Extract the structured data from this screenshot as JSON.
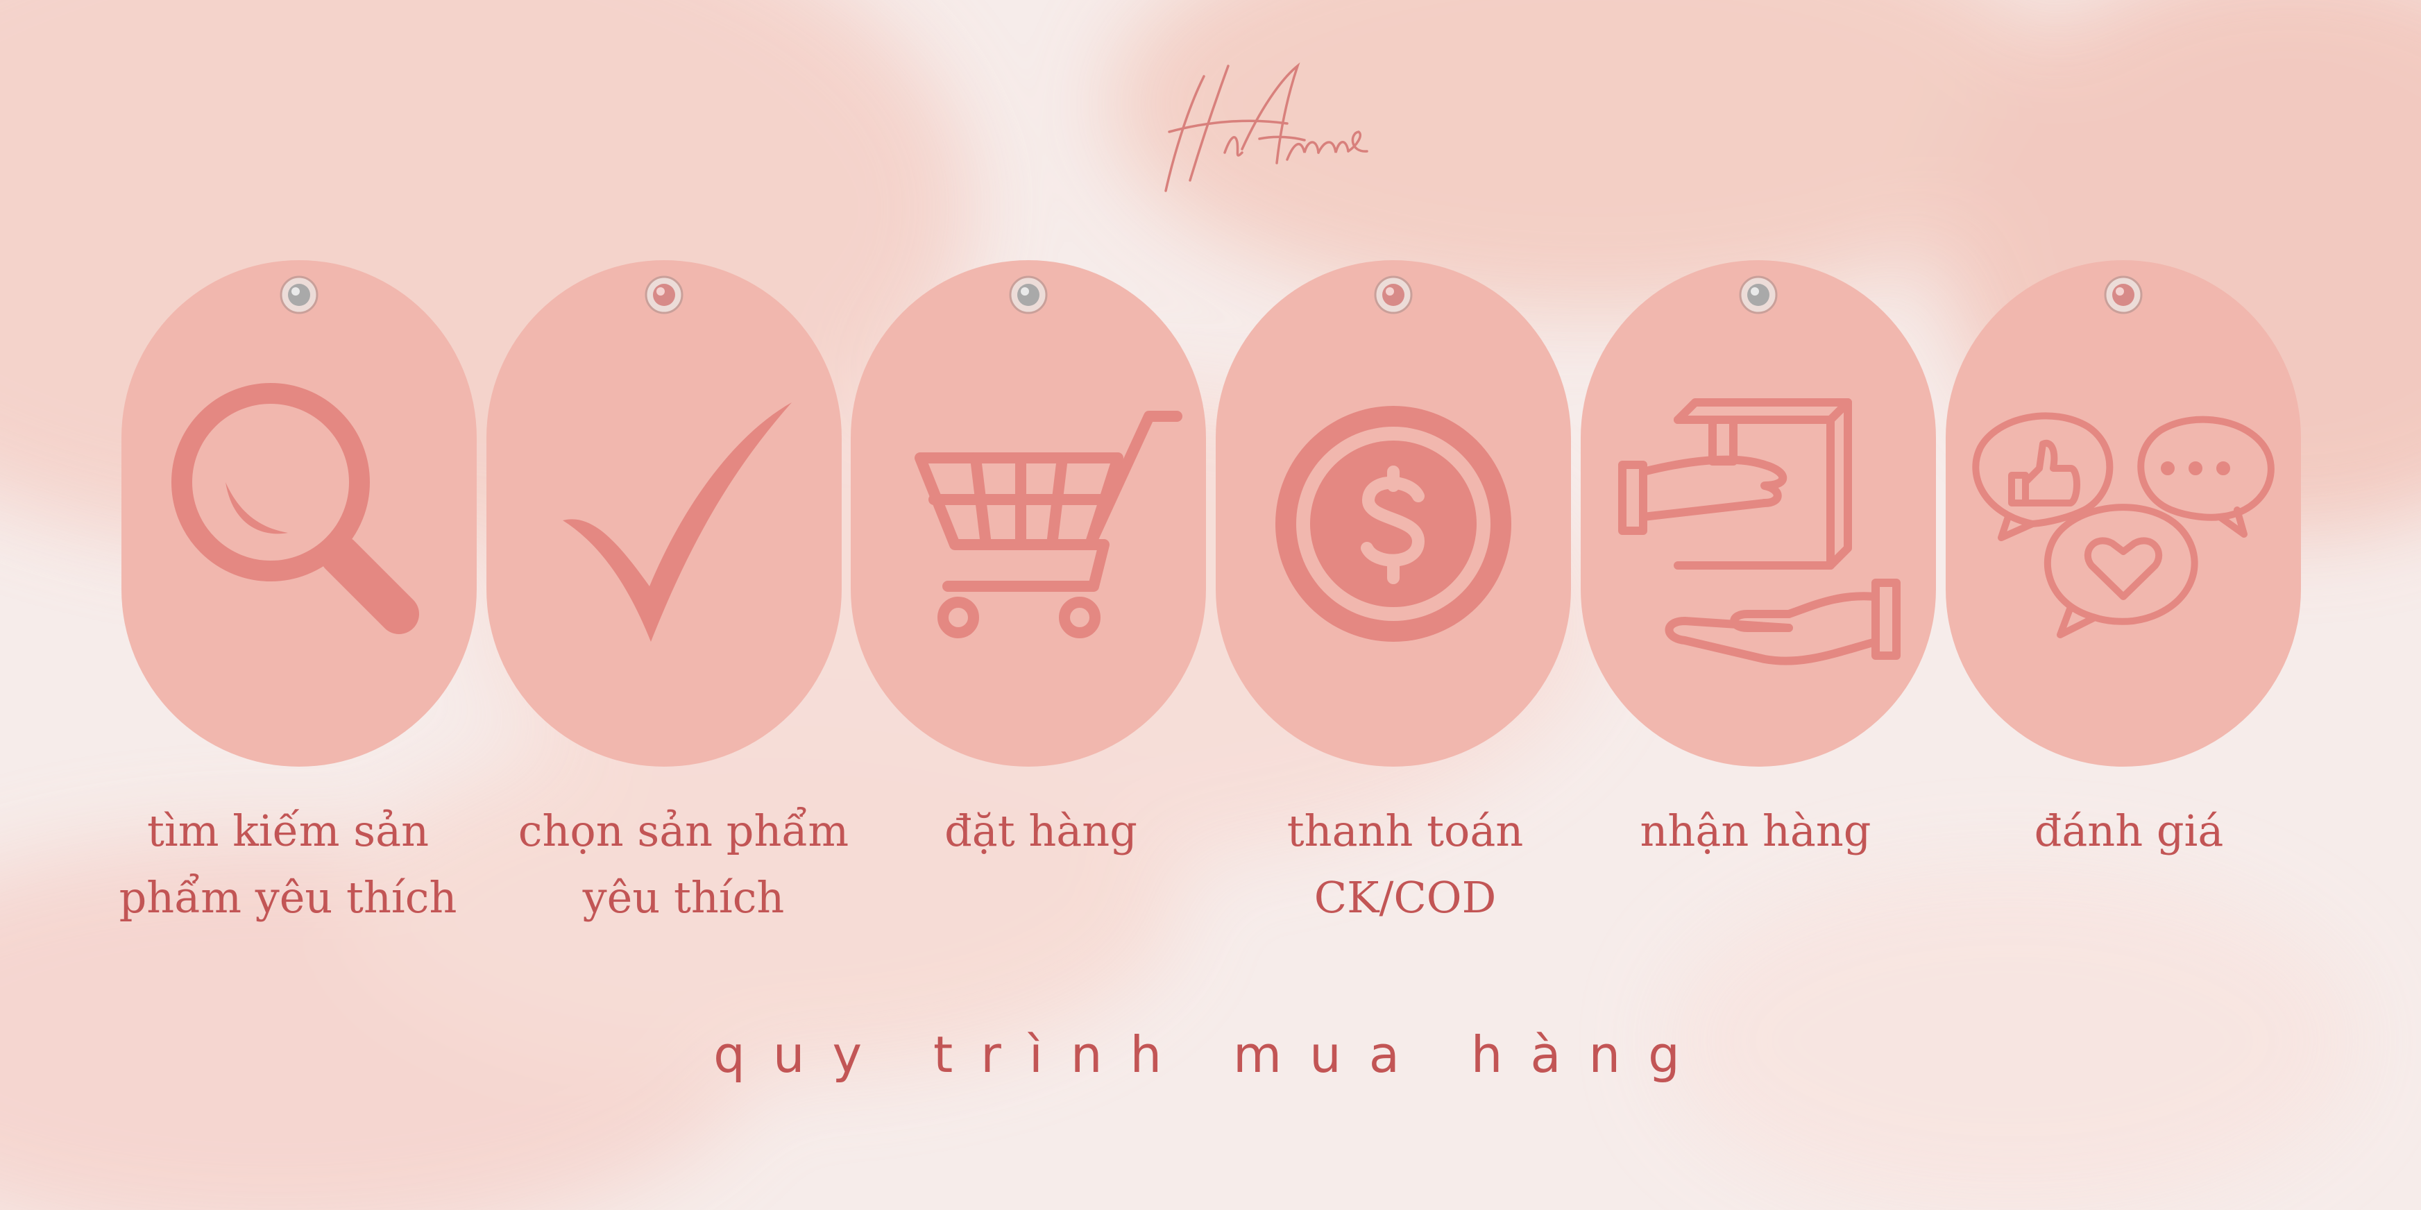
{
  "brand": {
    "name": "HiAnne"
  },
  "steps": [
    {
      "label": "tìm kiếm sản\nphẩm yêu thích",
      "icon": "magnifier-icon"
    },
    {
      "label": "chọn sản phẩm\nyêu thích",
      "icon": "checkmark-icon"
    },
    {
      "label": "đặt hàng",
      "icon": "shopping-cart-icon"
    },
    {
      "label": "thanh toán\nCK/COD",
      "icon": "dollar-coin-icon"
    },
    {
      "label": "nhận hàng",
      "icon": "package-handover-icon"
    },
    {
      "label": "đánh giá",
      "icon": "feedback-bubbles-icon"
    }
  ],
  "footer": {
    "title": "quy trình mua hàng"
  },
  "colors": {
    "tag": "#f1b7ae",
    "icon": "#e48882",
    "text": "#c25555",
    "background": "#f6ecea"
  }
}
